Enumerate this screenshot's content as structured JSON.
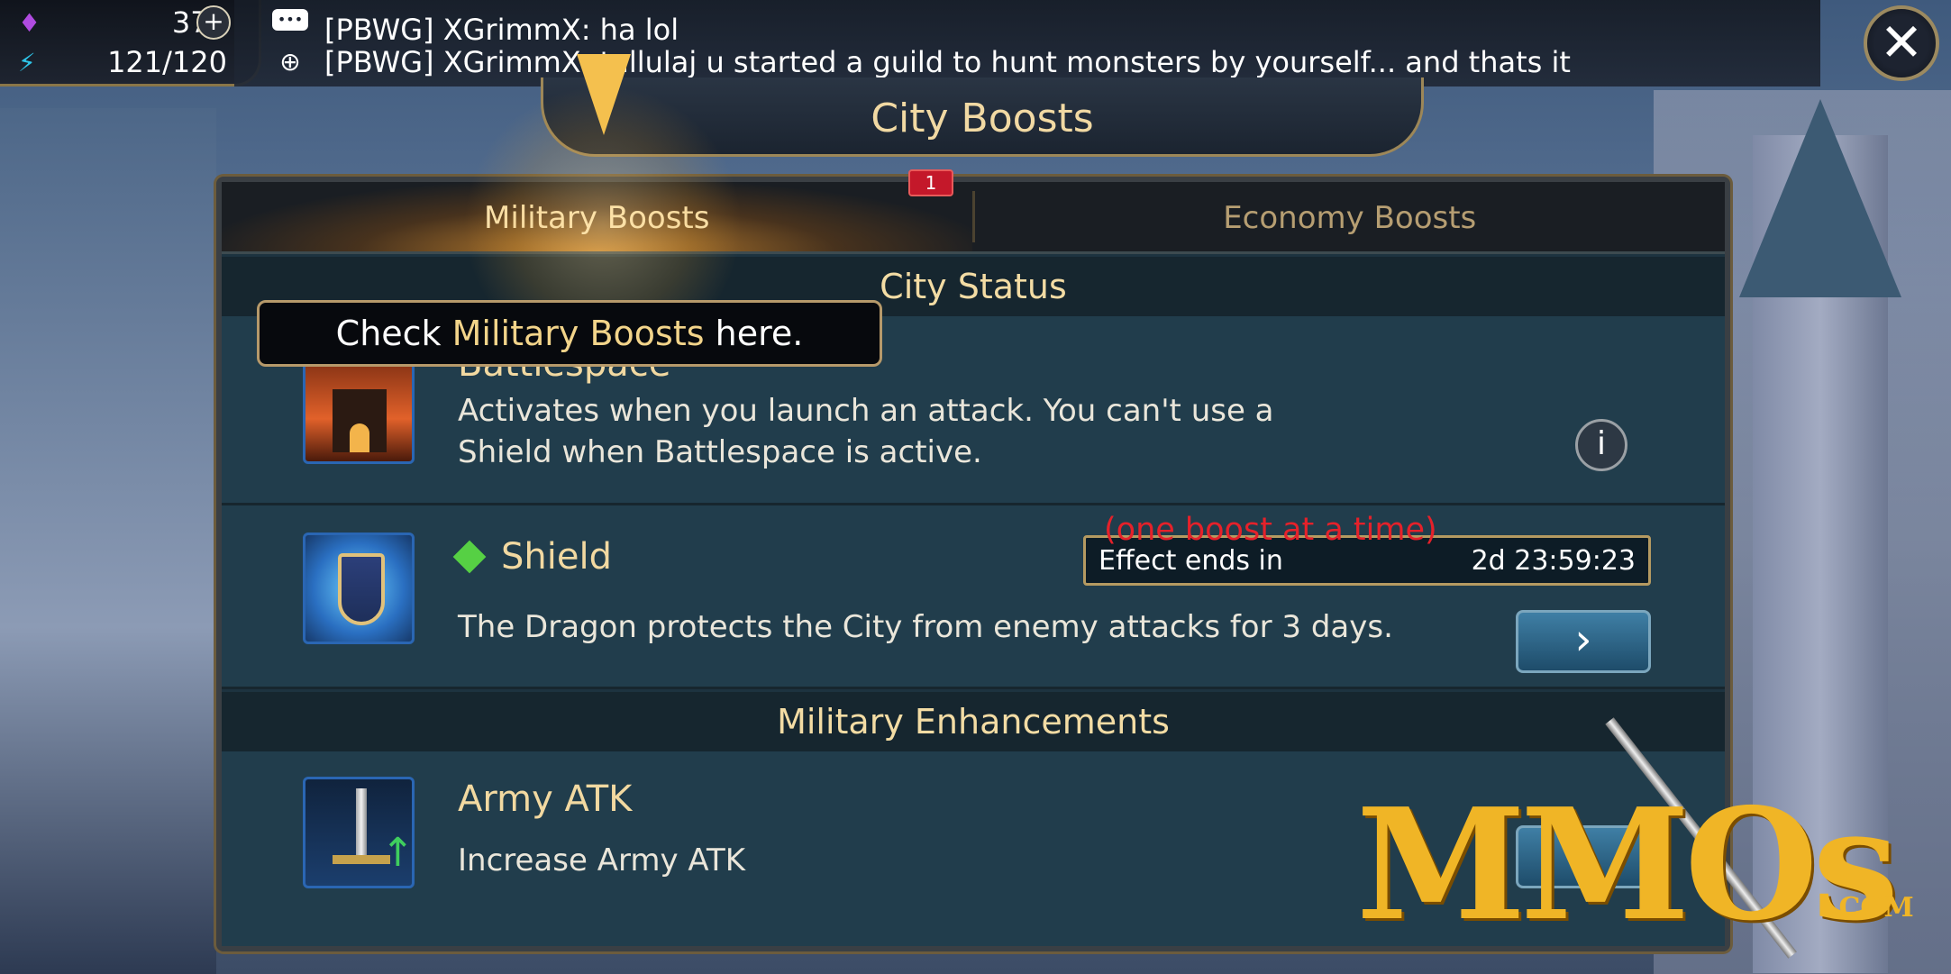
{
  "resources": {
    "gems": "370",
    "energy": "121/120",
    "gem_icon": "gem-icon",
    "energy_icon": "lightning-icon"
  },
  "chat": {
    "line1": "[PBWG] XGrimmX: ha lol",
    "line2": "[PBWG] XGrimmX: tallulaj u started a guild to hunt monsters by yourself... and thats it",
    "line1_icon": "chat-bubble-icon",
    "line2_icon": "globe-icon"
  },
  "title": "City Boosts",
  "tabs": [
    {
      "label": "Military Boosts",
      "active": true
    },
    {
      "label": "Economy Boosts",
      "active": false
    }
  ],
  "tab_badge": "1",
  "tip": {
    "prefix": "Check ",
    "highlight": "Military Boosts",
    "suffix": " here."
  },
  "city_status": {
    "heading": "City Status",
    "items": [
      {
        "name": "Battlespace",
        "description": "Activates when you launch an attack. You can't use a Shield when Battlespace is active."
      },
      {
        "name": "Shield",
        "description": "The Dragon protects the City from enemy attacks for 3 days.",
        "effect_label": "Effect ends in",
        "effect_time": "2d 23:59:23"
      }
    ]
  },
  "enhancements": {
    "heading": "Military Enhancements",
    "note": "(one boost at a time)",
    "items": [
      {
        "name": "Army ATK",
        "description": "Increase Army ATK"
      }
    ]
  },
  "watermark": {
    "text": "MMOs",
    "suffix": ".COM"
  },
  "colors": {
    "accent_gold": "#f2d9a1",
    "badge_red": "#c4182a",
    "note_red": "#e5212a"
  }
}
